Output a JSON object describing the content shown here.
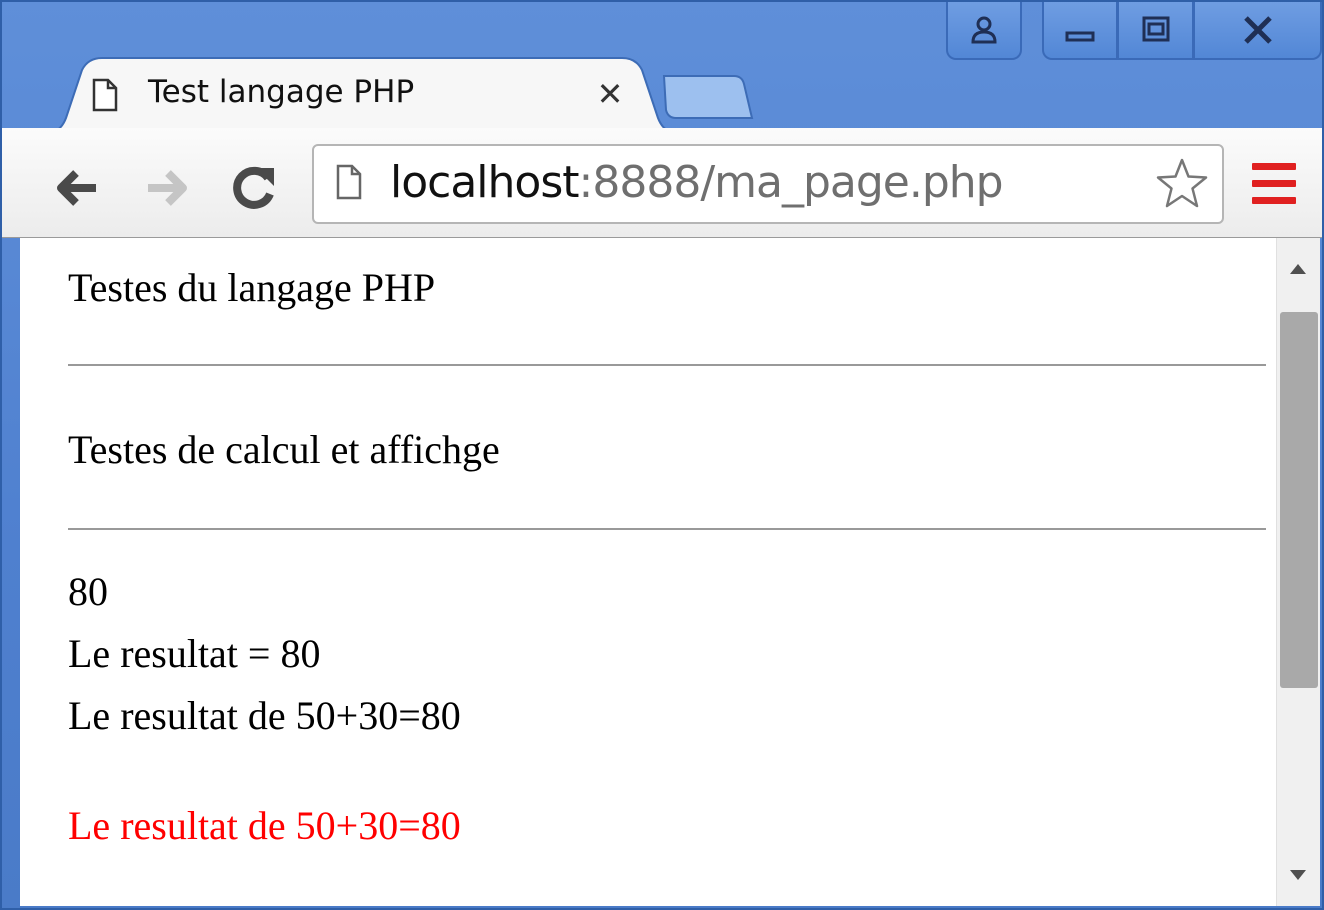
{
  "window": {
    "caption_buttons": {
      "user": "person-icon",
      "minimize": "minimize-icon",
      "maximize": "maximize-icon",
      "close": "close-icon"
    }
  },
  "tabs": [
    {
      "title": "Test langage PHP",
      "active": true,
      "close_glyph": "✕"
    }
  ],
  "toolbar": {
    "back": "back-arrow-icon",
    "forward": "forward-arrow-icon",
    "reload": "reload-icon",
    "url_host": "localhost",
    "url_rest": ":8888/ma_page.php",
    "bookmark": "star-icon",
    "menu": "menu-icon"
  },
  "page": {
    "title": "Testes du langage PHP",
    "section": "Testes de calcul et affichge",
    "results": [
      "80",
      "Le resultat = 80",
      "Le resultat de 50+30=80"
    ],
    "red_result": "Le resultat de 50+30=80"
  },
  "colors": {
    "title_bar": "#5b8bd6",
    "red_text": "#ff0000",
    "menu_icon": "#e02020"
  }
}
